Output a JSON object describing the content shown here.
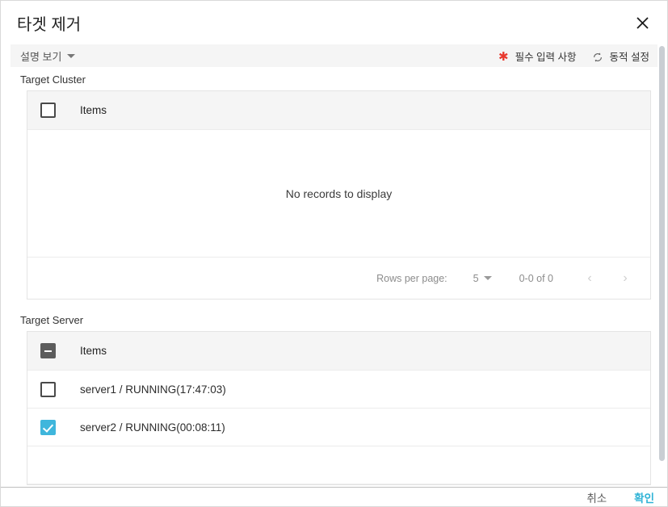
{
  "dialog": {
    "title": "타겟 제거",
    "close_icon": "close-icon"
  },
  "legend": {
    "description_toggle": "설명 보기",
    "required_marker": "✱",
    "required_label": "필수 입력 사항",
    "dynamic_icon": "sync-icon",
    "dynamic_label": "동적 설정"
  },
  "sections": [
    {
      "label": "Target Cluster",
      "header_checkbox_state": "unchecked",
      "column_header": "Items",
      "empty_message": "No records to display",
      "rows": [],
      "pagination": {
        "rows_per_page_label": "Rows per page:",
        "rows_per_page_value": "5",
        "range": "0-0 of 0",
        "prev_icon": "chevron-left-icon",
        "next_icon": "chevron-right-icon",
        "prev_glyph": "‹",
        "next_glyph": "›"
      }
    },
    {
      "label": "Target Server",
      "header_checkbox_state": "indeterminate",
      "column_header": "Items",
      "rows": [
        {
          "label": "server1 / RUNNING(17:47:03)",
          "checked": false
        },
        {
          "label": "server2 / RUNNING(00:08:11)",
          "checked": true
        }
      ]
    }
  ],
  "footer": {
    "cancel_label": "취소",
    "confirm_label": "확인"
  },
  "colors": {
    "accent": "#3fb6dc",
    "required_red": "#e8392e",
    "header_bg": "#f5f5f5",
    "border": "#e4e4e4"
  }
}
